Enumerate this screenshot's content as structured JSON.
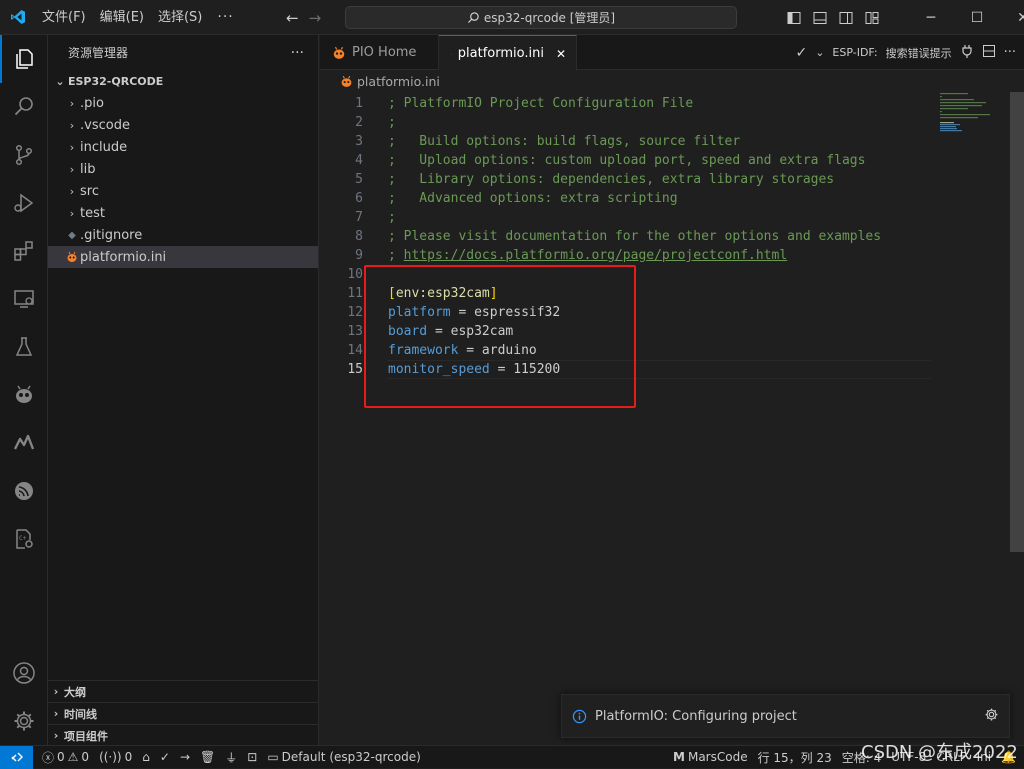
{
  "titlebar": {
    "menu": [
      "文件(F)",
      "编辑(E)",
      "选择(S)"
    ],
    "more": "···",
    "command_center": "esp32-qrcode [管理员]"
  },
  "sidebar": {
    "title": "资源管理器",
    "more": "···",
    "folder": "ESP32-QRCODE",
    "items": [
      {
        "label": ".pio",
        "type": "folder"
      },
      {
        "label": ".vscode",
        "type": "folder"
      },
      {
        "label": "include",
        "type": "folder"
      },
      {
        "label": "lib",
        "type": "folder"
      },
      {
        "label": "src",
        "type": "folder"
      },
      {
        "label": "test",
        "type": "folder"
      },
      {
        "label": ".gitignore",
        "type": "file"
      },
      {
        "label": "platformio.ini",
        "type": "file",
        "selected": true
      }
    ],
    "sections": [
      "大纲",
      "时间线",
      "项目组件"
    ]
  },
  "tabs": [
    {
      "label": "PIO Home",
      "active": false
    },
    {
      "label": "platformio.ini",
      "active": true
    }
  ],
  "tab_actions": {
    "esp_idf": "ESP-IDF:",
    "hint": "搜索错误提示"
  },
  "breadcrumb": "platformio.ini",
  "code_lines": [
    {
      "n": "1",
      "parts": [
        {
          "t": "; PlatformIO Project Configuration File",
          "c": "cmt"
        }
      ]
    },
    {
      "n": "2",
      "parts": [
        {
          "t": ";",
          "c": "cmt"
        }
      ]
    },
    {
      "n": "3",
      "parts": [
        {
          "t": ";   Build options: build flags, source filter",
          "c": "cmt"
        }
      ]
    },
    {
      "n": "4",
      "parts": [
        {
          "t": ";   Upload options: custom upload port, speed and extra flags",
          "c": "cmt"
        }
      ]
    },
    {
      "n": "5",
      "parts": [
        {
          "t": ";   Library options: dependencies, extra library storages",
          "c": "cmt"
        }
      ]
    },
    {
      "n": "6",
      "parts": [
        {
          "t": ";   Advanced options: extra scripting",
          "c": "cmt"
        }
      ]
    },
    {
      "n": "7",
      "parts": [
        {
          "t": ";",
          "c": "cmt"
        }
      ]
    },
    {
      "n": "8",
      "parts": [
        {
          "t": "; Please visit documentation for the other options and examples",
          "c": "cmt"
        }
      ]
    },
    {
      "n": "9",
      "parts": [
        {
          "t": "; ",
          "c": "cmt"
        },
        {
          "t": "https://docs.platformio.org/page/projectconf.html",
          "c": "cmt link"
        }
      ]
    },
    {
      "n": "10",
      "parts": []
    },
    {
      "n": "11",
      "parts": [
        {
          "t": "[",
          "c": "br"
        },
        {
          "t": "env:esp32cam",
          "c": "sec"
        },
        {
          "t": "]",
          "c": "br"
        }
      ]
    },
    {
      "n": "12",
      "parts": [
        {
          "t": "platform",
          "c": "key"
        },
        {
          "t": " = espressif32",
          "c": "val"
        }
      ]
    },
    {
      "n": "13",
      "parts": [
        {
          "t": "board",
          "c": "key"
        },
        {
          "t": " = esp32cam",
          "c": "val"
        }
      ]
    },
    {
      "n": "14",
      "parts": [
        {
          "t": "framework",
          "c": "key"
        },
        {
          "t": " = arduino",
          "c": "val"
        }
      ]
    },
    {
      "n": "15",
      "parts": [
        {
          "t": "monitor_speed",
          "c": "key"
        },
        {
          "t": " = 115200",
          "c": "val"
        }
      ],
      "current": true
    }
  ],
  "notification": {
    "text": "PlatformIO: Configuring project"
  },
  "statusbar": {
    "errors": "0",
    "warnings": "0",
    "ports": "0",
    "env": "Default (esp32-qrcode)",
    "marscode": "MarsCode",
    "position": "行 15，列 23",
    "spaces": "空格: 4",
    "encoding": "UTF-8",
    "eol": "CRLF",
    "lang": "Ini"
  },
  "watermark": "CSDN @东成2022",
  "colors": {
    "accent": "#0078d4",
    "highlight_box": "#e81b1b",
    "pio_orange": "#f5822a"
  }
}
